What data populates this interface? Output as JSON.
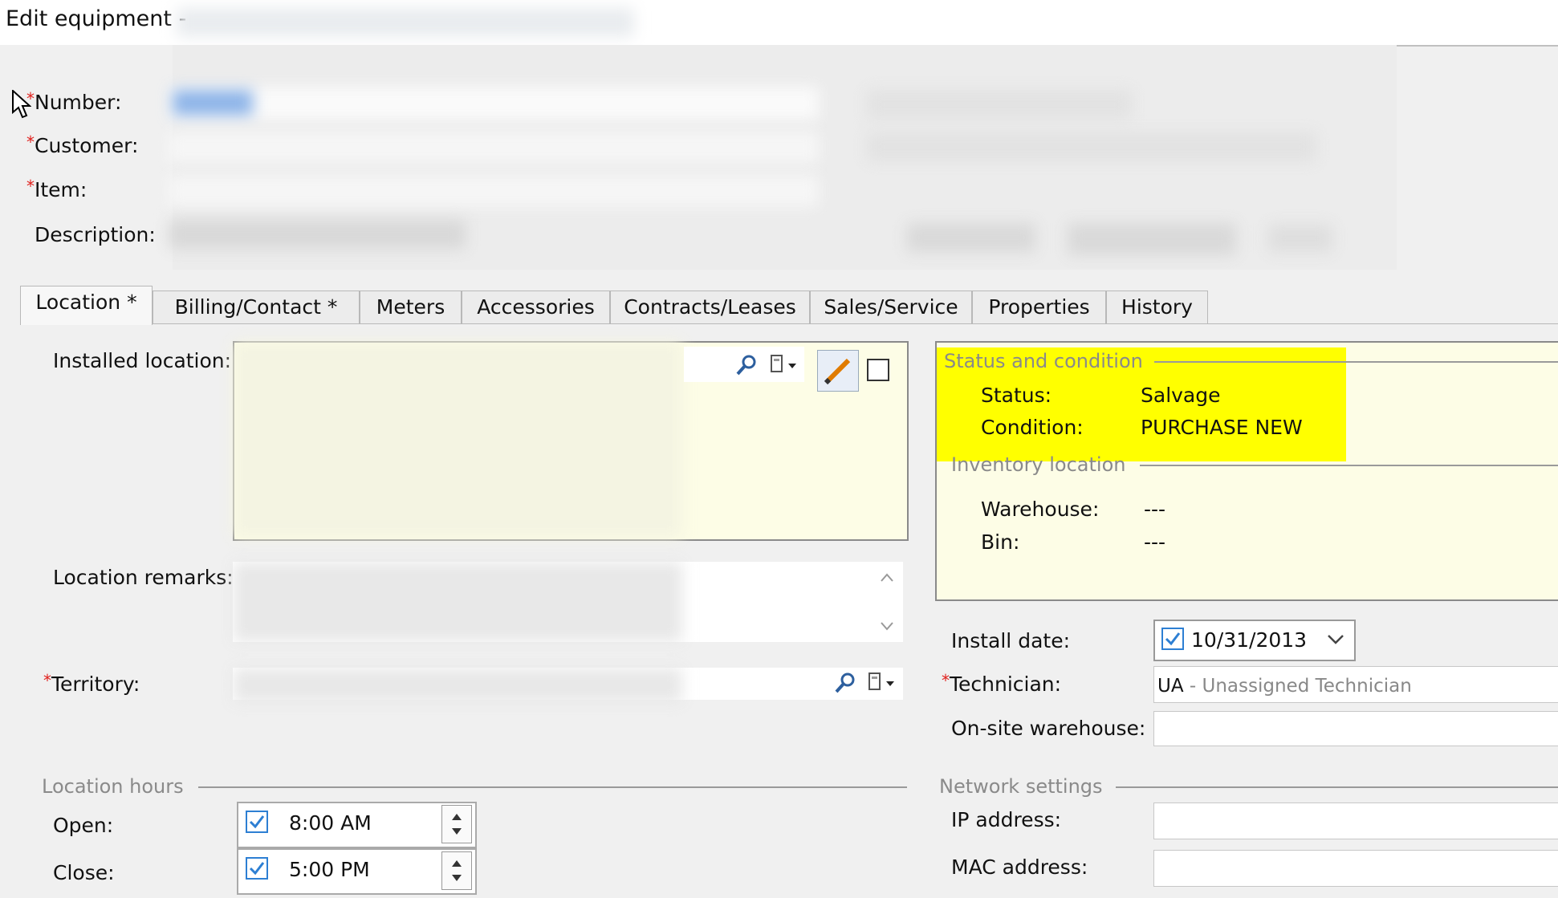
{
  "window": {
    "title": "Edit equipment -"
  },
  "header": {
    "number_label": "Number:",
    "customer_label": "Customer:",
    "item_label": "Item:",
    "description_label": "Description:"
  },
  "tabs": [
    {
      "label": "Location *",
      "active": true
    },
    {
      "label": "Billing/Contact *"
    },
    {
      "label": "Meters"
    },
    {
      "label": "Accessories"
    },
    {
      "label": "Contracts/Leases"
    },
    {
      "label": "Sales/Service"
    },
    {
      "label": "Properties"
    },
    {
      "label": "History"
    }
  ],
  "location": {
    "installed_location_label": "Installed location:",
    "location_remarks_label": "Location remarks:",
    "territory_label": "Territory:"
  },
  "status_condition": {
    "group_title": "Status and condition",
    "status_label": "Status:",
    "status_value": "Salvage",
    "condition_label": "Condition:",
    "condition_value": "PURCHASE NEW",
    "highlight_color": "#ffff00"
  },
  "inventory_location": {
    "group_title": "Inventory location",
    "warehouse_label": "Warehouse:",
    "warehouse_value": "---",
    "bin_label": "Bin:",
    "bin_value": "---"
  },
  "install": {
    "install_date_label": "Install date:",
    "install_date_value": "10/31/2013",
    "install_date_checked": true,
    "technician_label": "Technician:",
    "technician_code": "UA",
    "technician_name": " - Unassigned Technician",
    "onsite_warehouse_label": "On-site warehouse:"
  },
  "location_hours": {
    "group_title": "Location hours",
    "open_label": "Open:",
    "open_value": "8:00 AM",
    "close_label": "Close:",
    "close_value": "5:00 PM"
  },
  "network": {
    "group_title": "Network settings",
    "ip_label": "IP address:",
    "mac_label": "MAC address:"
  },
  "icons": [
    "search-icon",
    "dropdown-menu-icon",
    "edit-pencil-icon",
    "checkbox-icon",
    "scroll-up-icon",
    "scroll-down-icon",
    "chevron-down-icon",
    "spin-up-icon",
    "spin-down-icon",
    "mouse-cursor-icon"
  ]
}
